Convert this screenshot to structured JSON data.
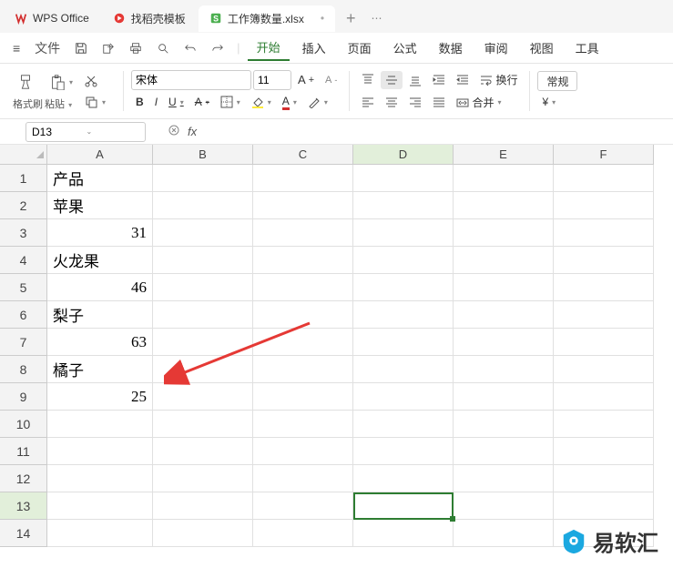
{
  "title_tabs": {
    "wps_office": "WPS Office",
    "template": "找稻壳模板",
    "file": "工作簿数量.xlsx"
  },
  "menu": {
    "file_label": "文件",
    "items": [
      "开始",
      "插入",
      "页面",
      "公式",
      "数据",
      "审阅",
      "视图",
      "工具"
    ],
    "active_index": 0
  },
  "ribbon": {
    "format_painter": "格式刷",
    "paste": "粘贴",
    "font_name": "宋体",
    "font_size": "11",
    "wrap": "换行",
    "merge": "合并",
    "normal": "常规"
  },
  "namebox": "D13",
  "columns": [
    "A",
    "B",
    "C",
    "D",
    "E",
    "F"
  ],
  "row_count": 14,
  "active_cell": {
    "col": 3,
    "row": 12
  },
  "cells": {
    "A1": "产品",
    "A2": "苹果",
    "A3_num": "31",
    "A4": "火龙果",
    "A5_num": "46",
    "A6": "梨子",
    "A7_num": "63",
    "A8": "橘子",
    "A9_num": "25"
  },
  "chart_data": {
    "type": "table",
    "title": "产品",
    "categories": [
      "苹果",
      "火龙果",
      "梨子",
      "橘子"
    ],
    "values": [
      31,
      46,
      63,
      25
    ]
  },
  "watermark": "易软汇"
}
